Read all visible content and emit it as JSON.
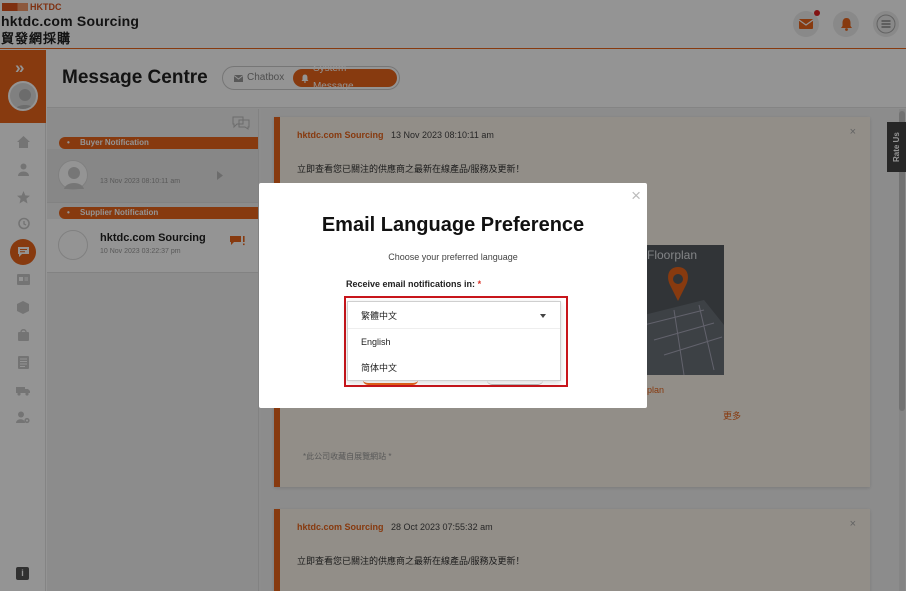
{
  "header": {
    "logo_tag": "HKTDC",
    "logo_title": "hktdc.com Sourcing",
    "logo_sub": "貿發網採購",
    "icons": [
      "mail-icon",
      "bell-icon",
      "menu-icon"
    ]
  },
  "sidebar": {
    "expand_glyph": "»",
    "icons": [
      "home-icon",
      "user-icon",
      "star-icon",
      "history-icon",
      "message-icon",
      "card-icon",
      "cube-icon",
      "bag-icon",
      "document-icon",
      "truck-icon",
      "user-settings-icon"
    ],
    "info_glyph": "i"
  },
  "page": {
    "title": "Message Centre",
    "tabs": [
      {
        "label": "Chatbox",
        "active": false
      },
      {
        "label": "System Message",
        "active": true
      }
    ]
  },
  "message_list": {
    "sections": [
      {
        "label": "Buyer Notification",
        "items": [
          {
            "name": "",
            "date": "13 Nov 2023 08:10:11 am"
          }
        ]
      },
      {
        "label": "Supplier Notification",
        "items": [
          {
            "name": "hktdc.com Sourcing",
            "date": "10 Nov 2023 03:22:37 pm"
          }
        ]
      }
    ]
  },
  "messages": [
    {
      "source": "hktdc.com Sourcing",
      "timestamp": "13 Nov 2023 08:10:11 am",
      "body": "立即查看您已關注的供應商之最新在線產品/服務及更新！",
      "image_label": "Floorplan",
      "image_caption": "plan",
      "more_label": "更多",
      "footer": "*此公司收藏自展覽網站 *"
    },
    {
      "source": "hktdc.com Sourcing",
      "timestamp": "28 Oct 2023 07:55:32 am",
      "body": "立即查看您已關注的供應商之最新在線產品/服務及更新！"
    }
  ],
  "rate_us": "Rate Us",
  "modal": {
    "title": "Email Language Preference",
    "subtitle": "Choose your preferred language",
    "field_label": "Receive email notifications in:",
    "required_mark": "*",
    "selected": "繁體中文",
    "options": [
      "English",
      "简体中文"
    ],
    "close_glyph": "×"
  },
  "colors": {
    "accent": "#e8641b",
    "highlight_border": "#c8151b"
  }
}
